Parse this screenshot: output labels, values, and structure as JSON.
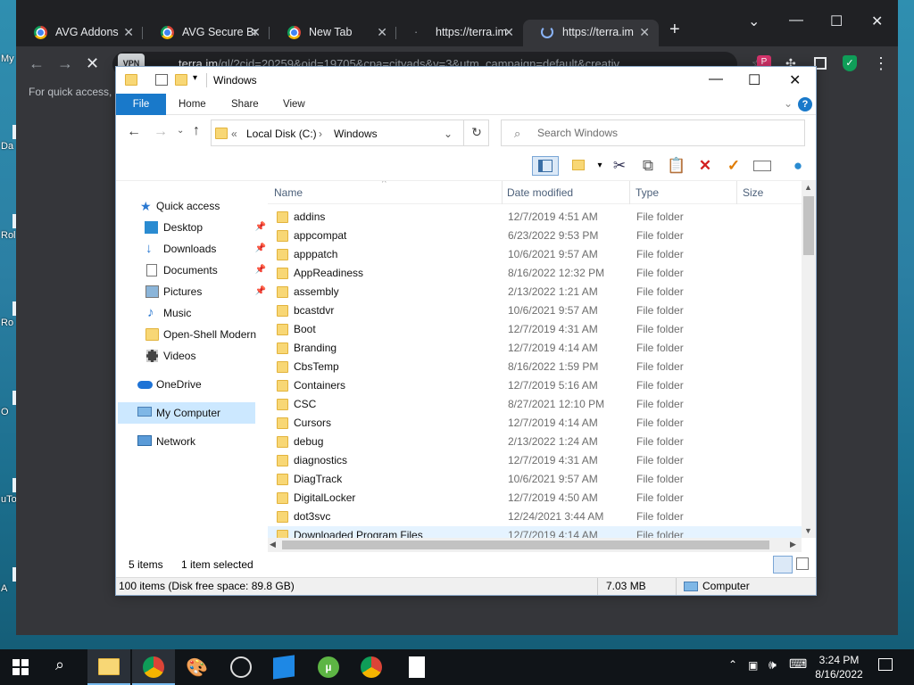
{
  "desktop": {
    "labels": [
      "My",
      "Da",
      "Rol",
      "Ro",
      "O",
      "uTo",
      "A"
    ]
  },
  "browser": {
    "tabs": [
      {
        "label": "AVG Addons",
        "active": false
      },
      {
        "label": "AVG Secure Br",
        "active": false
      },
      {
        "label": "New Tab",
        "active": false
      },
      {
        "label": "https://terra.im",
        "active": false
      },
      {
        "label": "https://terra.im",
        "active": true
      }
    ],
    "new_tab": "+",
    "address_host": "terra.im",
    "address_path": "/gl/?cid=20259&oid=19705&cpa=cityads&v=3&utm_campaign=default&creativ",
    "vpn_badge": "VPN",
    "quick_access_hint": "For quick access, p",
    "profile_letter": "P"
  },
  "explorer": {
    "title": "Windows",
    "ribbon_tabs": [
      "File",
      "Home",
      "Share",
      "View"
    ],
    "address": {
      "prefix": "«",
      "segments": [
        "Local Disk (C:)",
        "Windows"
      ],
      "separator": "›"
    },
    "search_placeholder": "Search Windows",
    "nav": {
      "quick_access": "Quick access",
      "items": [
        {
          "label": "Desktop",
          "pinned": true
        },
        {
          "label": "Downloads",
          "pinned": true
        },
        {
          "label": "Documents",
          "pinned": true
        },
        {
          "label": "Pictures",
          "pinned": true
        },
        {
          "label": "Music",
          "pinned": false
        },
        {
          "label": "Open-Shell Modern",
          "pinned": false
        },
        {
          "label": "Videos",
          "pinned": false
        }
      ],
      "onedrive": "OneDrive",
      "my_computer": "My Computer",
      "network": "Network"
    },
    "columns": {
      "name": "Name",
      "date": "Date modified",
      "type": "Type",
      "size": "Size"
    },
    "files": [
      {
        "name": "addins",
        "date": "12/7/2019 4:51 AM",
        "type": "File folder"
      },
      {
        "name": "appcompat",
        "date": "6/23/2022 9:53 PM",
        "type": "File folder"
      },
      {
        "name": "apppatch",
        "date": "10/6/2021 9:57 AM",
        "type": "File folder"
      },
      {
        "name": "AppReadiness",
        "date": "8/16/2022 12:32 PM",
        "type": "File folder"
      },
      {
        "name": "assembly",
        "date": "2/13/2022 1:21 AM",
        "type": "File folder"
      },
      {
        "name": "bcastdvr",
        "date": "10/6/2021 9:57 AM",
        "type": "File folder"
      },
      {
        "name": "Boot",
        "date": "12/7/2019 4:31 AM",
        "type": "File folder"
      },
      {
        "name": "Branding",
        "date": "12/7/2019 4:14 AM",
        "type": "File folder"
      },
      {
        "name": "CbsTemp",
        "date": "8/16/2022 1:59 PM",
        "type": "File folder"
      },
      {
        "name": "Containers",
        "date": "12/7/2019 5:16 AM",
        "type": "File folder"
      },
      {
        "name": "CSC",
        "date": "8/27/2021 12:10 PM",
        "type": "File folder"
      },
      {
        "name": "Cursors",
        "date": "12/7/2019 4:14 AM",
        "type": "File folder"
      },
      {
        "name": "debug",
        "date": "2/13/2022 1:24 AM",
        "type": "File folder"
      },
      {
        "name": "diagnostics",
        "date": "12/7/2019 4:31 AM",
        "type": "File folder"
      },
      {
        "name": "DiagTrack",
        "date": "10/6/2021 9:57 AM",
        "type": "File folder"
      },
      {
        "name": "DigitalLocker",
        "date": "12/7/2019 4:50 AM",
        "type": "File folder"
      },
      {
        "name": "dot3svc",
        "date": "12/24/2021 3:44 AM",
        "type": "File folder"
      },
      {
        "name": "Downloaded Program Files",
        "date": "12/7/2019 4:14 AM",
        "type": "File folder"
      }
    ],
    "status": {
      "items": "5 items",
      "selected": "1 item selected",
      "summary": "100 items (Disk free space: 89.8 GB)",
      "size": "7.03 MB",
      "location": "Computer"
    }
  },
  "taskbar": {
    "time": "3:24 PM",
    "date": "8/16/2022"
  }
}
